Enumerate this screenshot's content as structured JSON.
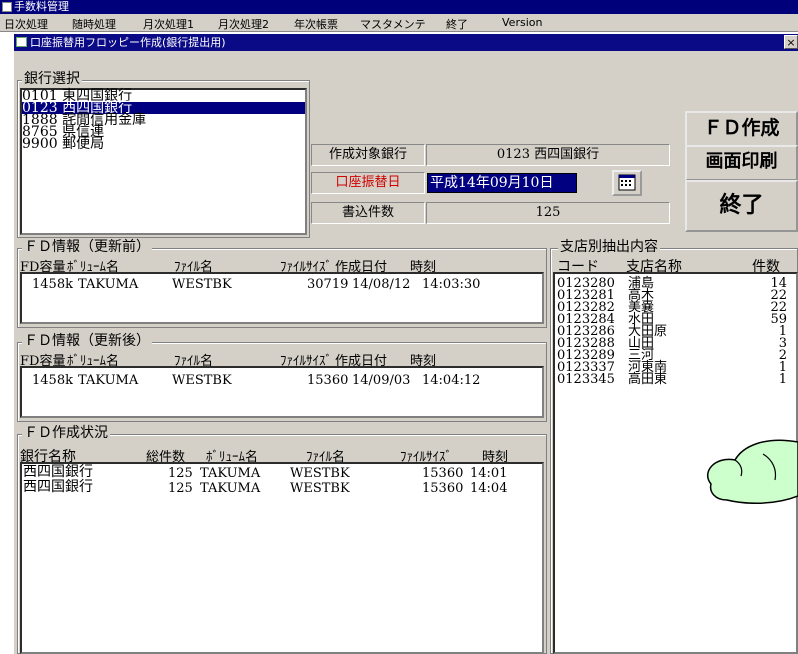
{
  "app_title": "手数料管理",
  "menu": [
    "日次処理",
    "随時処理",
    "月次処理1",
    "月次処理2",
    "年次帳票",
    "マスタメンテ",
    "終了",
    "Version"
  ],
  "window_title": "口座振替用フロッピー作成(銀行提出用)",
  "close_glyph": "×",
  "bank_select": {
    "label": "銀行選択",
    "items": [
      "0101 東四国銀行",
      "0123 西四国銀行",
      "1888 詫間信用金庫",
      "8765 県信連",
      "9900 郵便局"
    ],
    "selected_index": 1
  },
  "target_bank": {
    "label": "作成対象銀行",
    "value": "0123 西四国銀行"
  },
  "transfer_date": {
    "label": "口座振替日",
    "value": "平成14年09月10日"
  },
  "write_count": {
    "label": "書込件数",
    "value": "125"
  },
  "buttons": {
    "fd_create": "ＦＤ作成",
    "print_screen": "画面印刷",
    "exit": "終了"
  },
  "fd_before": {
    "label": "ＦＤ情報（更新前）",
    "headers": [
      "FD容量",
      "ﾎﾞﾘｭｰﾑ名",
      "ﾌｧｲﾙ名",
      "ﾌｧｲﾙｻｲｽﾞ",
      "作成日付",
      "時刻"
    ],
    "row": [
      "1458k",
      "TAKUMA",
      "WESTBK",
      "30719",
      "14/08/12",
      "14:03:30"
    ]
  },
  "fd_after": {
    "label": "ＦＤ情報（更新後）",
    "headers": [
      "FD容量",
      "ﾎﾞﾘｭｰﾑ名",
      "ﾌｧｲﾙ名",
      "ﾌｧｲﾙｻｲｽﾞ",
      "作成日付",
      "時刻"
    ],
    "row": [
      "1458k",
      "TAKUMA",
      "WESTBK",
      "15360",
      "14/09/03",
      "14:04:12"
    ]
  },
  "fd_status": {
    "label": "ＦＤ作成状況",
    "headers": [
      "銀行名称",
      "総件数",
      "ﾎﾞﾘｭｰﾑ名",
      "ﾌｧｲﾙ名",
      "ﾌｧｲﾙｻｲｽﾞ",
      "時刻"
    ],
    "rows": [
      [
        "西四国銀行",
        "125",
        "TAKUMA",
        "WESTBK",
        "15360",
        "14:01"
      ],
      [
        "西四国銀行",
        "125",
        "TAKUMA",
        "WESTBK",
        "15360",
        "14:04"
      ]
    ]
  },
  "branch": {
    "label": "支店別抽出内容",
    "headers": [
      "コード",
      "支店名称",
      "件数"
    ],
    "rows": [
      [
        "0123280",
        "浦島",
        "14"
      ],
      [
        "0123281",
        "高木",
        "22"
      ],
      [
        "0123282",
        "美嚢",
        "22"
      ],
      [
        "0123284",
        "水田",
        "59"
      ],
      [
        "0123286",
        "大田原",
        "1"
      ],
      [
        "0123288",
        "山田",
        "3"
      ],
      [
        "0123289",
        "三河",
        "2"
      ],
      [
        "0123337",
        "河東南",
        "1"
      ],
      [
        "0123345",
        "高田東",
        "1"
      ]
    ]
  }
}
